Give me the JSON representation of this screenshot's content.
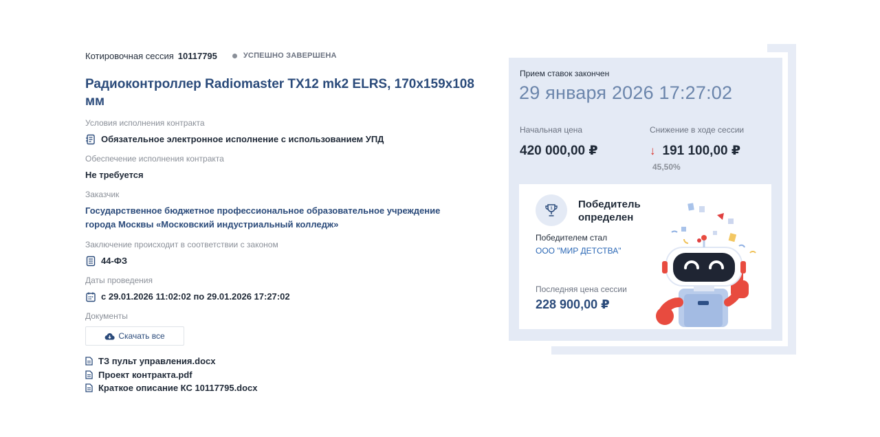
{
  "session": {
    "label": "Котировочная сессия",
    "number": "10117795",
    "status": "УСПЕШНО ЗАВЕРШЕНА"
  },
  "title": "Радиоконтроллер Radiomaster TX12 mk2 ELRS, 170x159x108 мм",
  "contract_terms": {
    "label": "Условия исполнения контракта",
    "value": "Обязательное электронное исполнение с использованием УПД"
  },
  "security": {
    "label": "Обеспечение исполнения контракта",
    "value": "Не требуется"
  },
  "customer": {
    "label": "Заказчик",
    "value": "Государственное бюджетное профессиональное образовательное учреждение города Москвы «Московский индустриальный колледж»"
  },
  "law": {
    "label": "Заключение происходит в соответствии с законом",
    "value": "44-ФЗ"
  },
  "dates": {
    "label": "Даты проведения",
    "value": "с 29.01.2026 11:02:02 по 29.01.2026 17:27:02"
  },
  "documents": {
    "label": "Документы",
    "download_all": "Скачать все",
    "files": [
      "ТЗ пульт управления.docx",
      "Проект контракта.pdf",
      "Краткое описание КС 10117795.docx"
    ]
  },
  "card": {
    "bids_closed_label": "Прием ставок закончен",
    "closed_at": "29 января 2026 17:27:02",
    "start_price_label": "Начальная цена",
    "start_price": "420 000,00 ₽",
    "drop_label": "Снижение в ходе сессии",
    "drop_value": "191 100,00 ₽",
    "drop_percent": "45,50%",
    "winner": {
      "title": "Победитель определен",
      "by_label": "Победителем стал",
      "name": "ООО \"МИР ДЕТСТВА\"",
      "last_price_label": "Последняя цена сессии",
      "last_price": "228 900,00 ₽"
    }
  },
  "colors": {
    "accent": "#2a4a7a",
    "card_bg": "#e4eaf5",
    "drop_arrow": "#d9342b",
    "link": "#2a67b5"
  },
  "icons": [
    "document-sign-icon",
    "document-list-icon",
    "calendar-icon",
    "cloud-download-icon",
    "file-icon",
    "trophy-icon",
    "down-arrow-icon"
  ]
}
